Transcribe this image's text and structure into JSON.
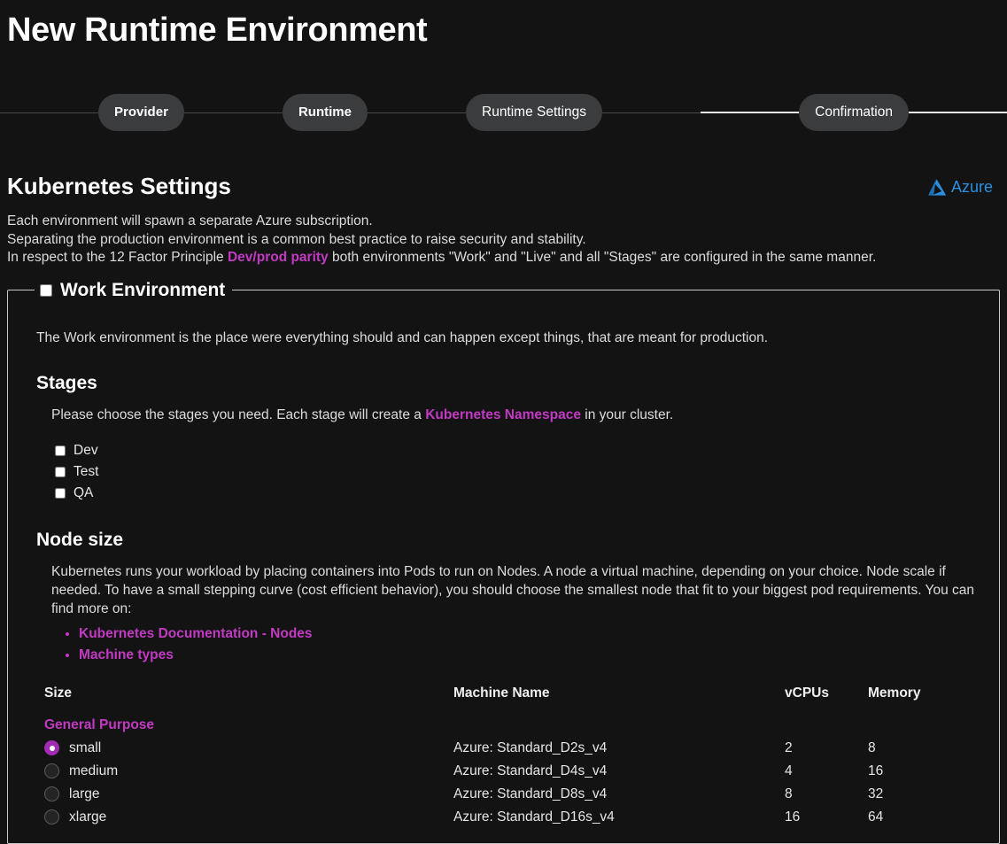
{
  "page": {
    "title": "New Runtime Environment"
  },
  "stepper": {
    "steps": [
      {
        "label": "Provider",
        "active": true
      },
      {
        "label": "Runtime",
        "active": true
      },
      {
        "label": "Runtime Settings",
        "active": false
      },
      {
        "label": "Confirmation",
        "active": false
      }
    ]
  },
  "section": {
    "title": "Kubernetes Settings",
    "provider": {
      "name": "Azure",
      "icon": "azure-logo-icon",
      "color": "#2b8fe0"
    },
    "intro": {
      "line1": "Each environment will spawn a separate Azure subscription.",
      "line2": "Separating the production environment is a common best practice to raise security and stability.",
      "line3_pre": "In respect to the 12 Factor Principle ",
      "line3_link": "Dev/prod parity",
      "line3_post": " both environments \"Work\" and \"Live\" and all \"Stages\" are configured in the same manner."
    }
  },
  "work_environment": {
    "legend": "Work Environment",
    "checkbox_checked": false,
    "description": "The Work environment is the place were everything should and can happen except things, that are meant for production.",
    "stages": {
      "heading": "Stages",
      "desc_pre": "Please choose the stages you need. Each stage will create a ",
      "desc_link": "Kubernetes Namespace",
      "desc_post": " in your cluster.",
      "items": [
        {
          "label": "Dev",
          "checked": false
        },
        {
          "label": "Test",
          "checked": false
        },
        {
          "label": "QA",
          "checked": false
        }
      ]
    },
    "node_size": {
      "heading": "Node size",
      "description": "Kubernetes runs your workload by placing containers into Pods to run on Nodes. A node a virtual machine, depending on your choice. Node scale if needed. To have a small stepping curve (cost efficient behavior), you should choose the smallest node that fit to your biggest pod requirements. You can find more on:",
      "links": [
        "Kubernetes Documentation - Nodes",
        "Machine types"
      ],
      "table": {
        "columns": [
          "Size",
          "Machine Name",
          "vCPUs",
          "Memory"
        ],
        "groups": [
          {
            "name": "General Purpose",
            "rows": [
              {
                "size": "small",
                "machine": "Azure: Standard_D2s_v4",
                "vcpus": "2",
                "memory": "8",
                "selected": true
              },
              {
                "size": "medium",
                "machine": "Azure: Standard_D4s_v4",
                "vcpus": "4",
                "memory": "16",
                "selected": false
              },
              {
                "size": "large",
                "machine": "Azure: Standard_D8s_v4",
                "vcpus": "8",
                "memory": "32",
                "selected": false
              },
              {
                "size": "xlarge",
                "machine": "Azure: Standard_D16s_v4",
                "vcpus": "16",
                "memory": "64",
                "selected": false
              }
            ]
          }
        ]
      }
    }
  },
  "colors": {
    "background": "#131313",
    "accent_link": "#c23ac4",
    "accent_radio": "#a22bb3",
    "azure_blue": "#2b8fe0",
    "pill": "#3b3c3e"
  }
}
